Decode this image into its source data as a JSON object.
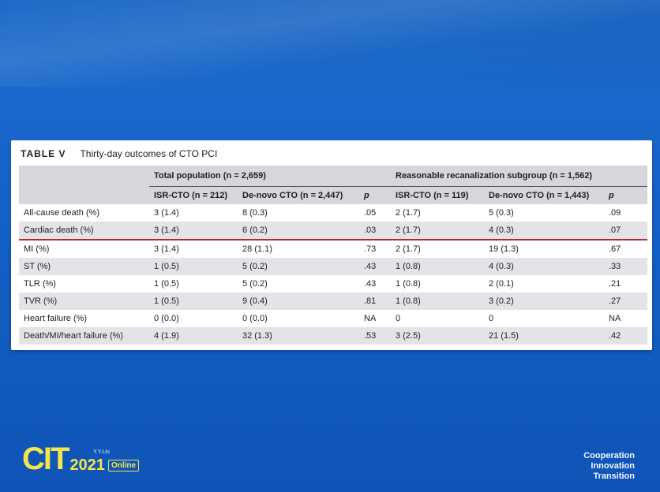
{
  "table": {
    "label": "TABLE V",
    "title": "Thirty-day outcomes of CTO PCI",
    "groups": [
      "Total population (n = 2,659)",
      "Reasonable recanalization subgroup (n = 1,562)"
    ],
    "subheaders": [
      "ISR-CTO (n = 212)",
      "De-novo CTO (n = 2,447)",
      "p",
      "ISR-CTO (n = 119)",
      "De-novo CTO (n = 1,443)",
      "p"
    ],
    "rows": [
      {
        "label": "All-cause death (%)",
        "cells": [
          "3 (1.4)",
          "8 (0.3)",
          ".05",
          "2 (1.7)",
          "5 (0.3)",
          ".09"
        ]
      },
      {
        "label": "Cardiac death (%)",
        "cells": [
          "3 (1.4)",
          "6 (0.2)",
          ".03",
          "2 (1.7)",
          "4 (0.3)",
          ".07"
        ]
      },
      {
        "label": "MI (%)",
        "cells": [
          "3 (1.4)",
          "28 (1.1)",
          ".73",
          "2 (1.7)",
          "19 (1.3)",
          ".67"
        ]
      },
      {
        "label": "ST (%)",
        "cells": [
          "1 (0.5)",
          "5 (0.2)",
          ".43",
          "1 (0.8)",
          "4 (0.3)",
          ".33"
        ]
      },
      {
        "label": "TLR (%)",
        "cells": [
          "1 (0.5)",
          "5 (0.2)",
          ".43",
          "1 (0.8)",
          "2 (0.1)",
          ".21"
        ]
      },
      {
        "label": "TVR (%)",
        "cells": [
          "1 (0.5)",
          "9 (0.4)",
          ".81",
          "1 (0.8)",
          "3 (0.2)",
          ".27"
        ]
      },
      {
        "label": "Heart failure (%)",
        "cells": [
          "0 (0.0)",
          "0 (0.0)",
          "NA",
          "0",
          "0",
          "NA"
        ]
      },
      {
        "label": "Death/MI/heart failure (%)",
        "cells": [
          "4 (1.9)",
          "32 (1.3)",
          ".53",
          "3 (2.5)",
          "21 (1.5)",
          ".42"
        ]
      }
    ]
  },
  "footer": {
    "logo_main": "CIT",
    "logo_year": "2021",
    "logo_online": "Online",
    "logo_small": "Y.Y.Liu",
    "motto": [
      "Cooperation",
      "Innovation",
      "Transition"
    ]
  },
  "colors": {
    "background": "#1662c8",
    "accent_yellow": "#f3e54a",
    "highlight_line": "#b8282a"
  }
}
